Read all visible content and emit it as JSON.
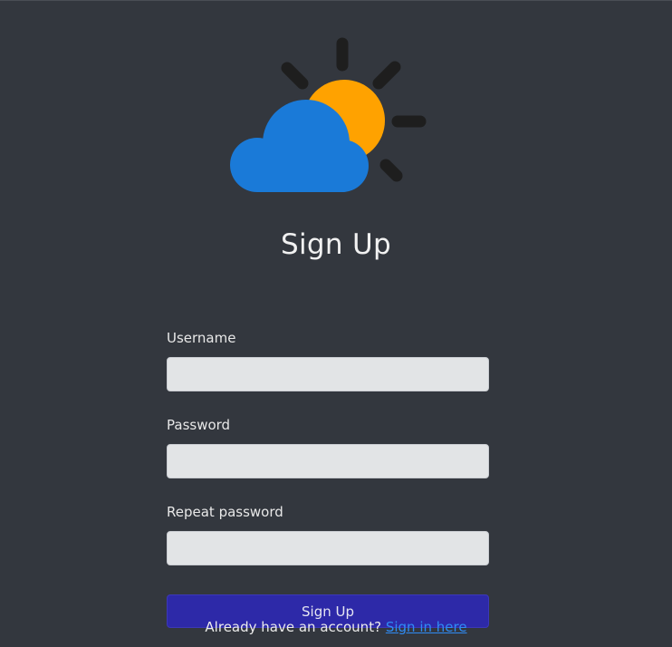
{
  "logo": {
    "icon": "weather-partly-cloudy-icon",
    "colors": {
      "sun": "#ffa200",
      "cloud": "#1a7ad8",
      "rays": "#1e1e1e"
    }
  },
  "title": "Sign Up",
  "form": {
    "username_label": "Username",
    "username_value": "",
    "password_label": "Password",
    "password_value": "",
    "repeat_label": "Repeat password",
    "repeat_value": "",
    "submit_label": "Sign Up"
  },
  "footer": {
    "prompt": "Already have an account?",
    "link_label": "Sign in here"
  },
  "colors": {
    "background": "#33373e",
    "input_bg": "#e2e4e6",
    "button_bg": "#2d29a8",
    "link": "#2f8cf5"
  }
}
